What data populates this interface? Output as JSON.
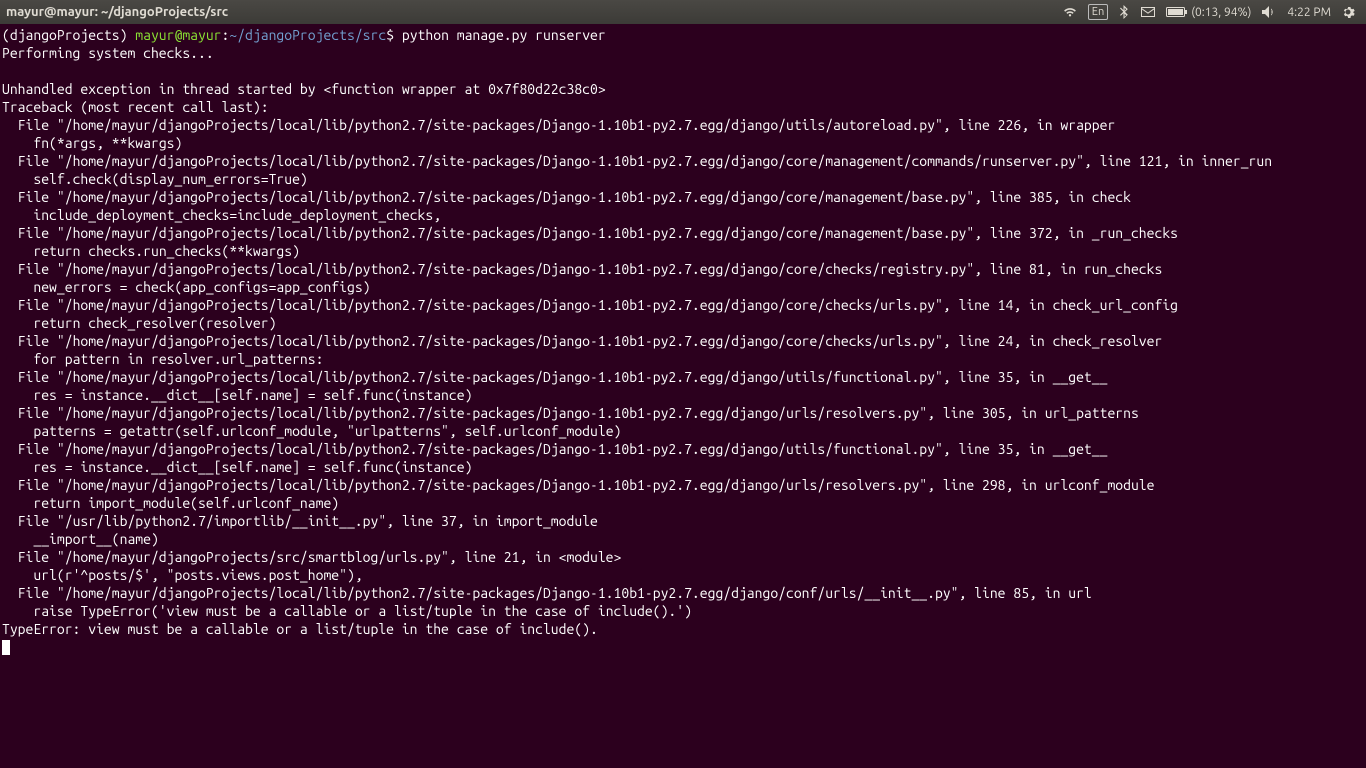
{
  "menubar": {
    "title": "mayur@mayur: ~/djangoProjects/src",
    "lang": "En",
    "battery": "(0:13, 94%)",
    "time": "4:22 PM"
  },
  "terminal": {
    "prompt_prefix": "(djangoProjects) ",
    "prompt_userhost": "mayur@mayur",
    "prompt_sep": ":",
    "prompt_path": "~/djangoProjects/src",
    "prompt_dollar": "$",
    "command": "python manage.py runserver",
    "lines": [
      "Performing system checks...",
      "",
      "Unhandled exception in thread started by <function wrapper at 0x7f80d22c38c0>",
      "Traceback (most recent call last):",
      "  File \"/home/mayur/djangoProjects/local/lib/python2.7/site-packages/Django-1.10b1-py2.7.egg/django/utils/autoreload.py\", line 226, in wrapper",
      "    fn(*args, **kwargs)",
      "  File \"/home/mayur/djangoProjects/local/lib/python2.7/site-packages/Django-1.10b1-py2.7.egg/django/core/management/commands/runserver.py\", line 121, in inner_run",
      "    self.check(display_num_errors=True)",
      "  File \"/home/mayur/djangoProjects/local/lib/python2.7/site-packages/Django-1.10b1-py2.7.egg/django/core/management/base.py\", line 385, in check",
      "    include_deployment_checks=include_deployment_checks,",
      "  File \"/home/mayur/djangoProjects/local/lib/python2.7/site-packages/Django-1.10b1-py2.7.egg/django/core/management/base.py\", line 372, in _run_checks",
      "    return checks.run_checks(**kwargs)",
      "  File \"/home/mayur/djangoProjects/local/lib/python2.7/site-packages/Django-1.10b1-py2.7.egg/django/core/checks/registry.py\", line 81, in run_checks",
      "    new_errors = check(app_configs=app_configs)",
      "  File \"/home/mayur/djangoProjects/local/lib/python2.7/site-packages/Django-1.10b1-py2.7.egg/django/core/checks/urls.py\", line 14, in check_url_config",
      "    return check_resolver(resolver)",
      "  File \"/home/mayur/djangoProjects/local/lib/python2.7/site-packages/Django-1.10b1-py2.7.egg/django/core/checks/urls.py\", line 24, in check_resolver",
      "    for pattern in resolver.url_patterns:",
      "  File \"/home/mayur/djangoProjects/local/lib/python2.7/site-packages/Django-1.10b1-py2.7.egg/django/utils/functional.py\", line 35, in __get__",
      "    res = instance.__dict__[self.name] = self.func(instance)",
      "  File \"/home/mayur/djangoProjects/local/lib/python2.7/site-packages/Django-1.10b1-py2.7.egg/django/urls/resolvers.py\", line 305, in url_patterns",
      "    patterns = getattr(self.urlconf_module, \"urlpatterns\", self.urlconf_module)",
      "  File \"/home/mayur/djangoProjects/local/lib/python2.7/site-packages/Django-1.10b1-py2.7.egg/django/utils/functional.py\", line 35, in __get__",
      "    res = instance.__dict__[self.name] = self.func(instance)",
      "  File \"/home/mayur/djangoProjects/local/lib/python2.7/site-packages/Django-1.10b1-py2.7.egg/django/urls/resolvers.py\", line 298, in urlconf_module",
      "    return import_module(self.urlconf_name)",
      "  File \"/usr/lib/python2.7/importlib/__init__.py\", line 37, in import_module",
      "    __import__(name)",
      "  File \"/home/mayur/djangoProjects/src/smartblog/urls.py\", line 21, in <module>",
      "    url(r'^posts/$', \"posts.views.post_home\"),",
      "  File \"/home/mayur/djangoProjects/local/lib/python2.7/site-packages/Django-1.10b1-py2.7.egg/django/conf/urls/__init__.py\", line 85, in url",
      "    raise TypeError('view must be a callable or a list/tuple in the case of include().')",
      "TypeError: view must be a callable or a list/tuple in the case of include()."
    ]
  }
}
